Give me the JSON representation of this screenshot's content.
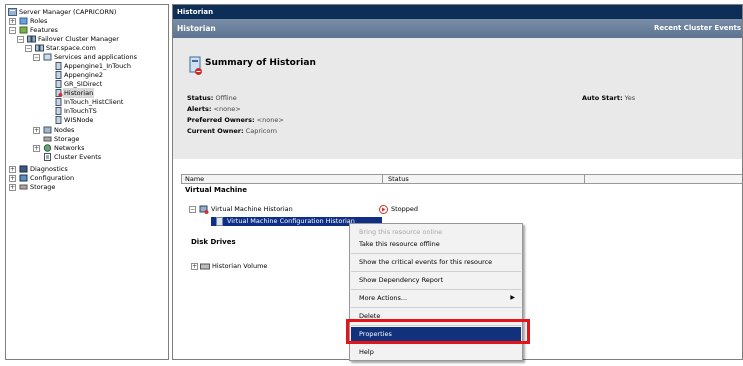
{
  "tree": {
    "items": [
      {
        "label": "Server Manager (CAPRICORN)",
        "expander": ""
      },
      {
        "label": "Roles",
        "expander": "+"
      },
      {
        "label": "Features",
        "expander": "−"
      },
      {
        "label": "Failover Cluster Manager",
        "expander": "−"
      },
      {
        "label": "Star.space.com",
        "expander": "−"
      },
      {
        "label": "Services and applications",
        "expander": "−"
      },
      {
        "label": "Appengine1_InTouch",
        "expander": ""
      },
      {
        "label": "Appengine2",
        "expander": ""
      },
      {
        "label": "GR_SIDirect",
        "expander": ""
      },
      {
        "label": "Historian",
        "expander": "",
        "selected": true
      },
      {
        "label": "InTouch_HistClient",
        "expander": ""
      },
      {
        "label": "InTouchTS",
        "expander": ""
      },
      {
        "label": "WISNode",
        "expander": ""
      },
      {
        "label": "Nodes",
        "expander": "+"
      },
      {
        "label": "Storage",
        "expander": ""
      },
      {
        "label": "Networks",
        "expander": "+"
      },
      {
        "label": "Cluster Events",
        "expander": ""
      },
      {
        "label": "Diagnostics",
        "expander": "+"
      },
      {
        "label": "Configuration",
        "expander": "+"
      },
      {
        "label": "Storage",
        "expander": "+"
      }
    ]
  },
  "header": {
    "top_title": "Historian",
    "sub_title": "Historian",
    "recent_events": "Recent Cluster Events"
  },
  "summary": {
    "title": "Summary of Historian",
    "status_label": "Status:",
    "status_value": "Offline",
    "alerts_label": "Alerts:",
    "alerts_value": "<none>",
    "preferred_owners_label": "Preferred Owners:",
    "preferred_owners_value": "<none>",
    "current_owner_label": "Current Owner:",
    "current_owner_value": "Capricorn",
    "auto_start_label": "Auto Start:",
    "auto_start_value": "Yes"
  },
  "table": {
    "col_name": "Name",
    "col_status": "Status",
    "group_vm": "Virtual Machine",
    "vm_name": "Virtual Machine Historian",
    "vm_status": "Stopped",
    "vm_config": "Virtual Machine Configuration Historian",
    "group_disk": "Disk Drives",
    "disk_name": "Historian Volume"
  },
  "context_menu": {
    "bring_online": "Bring this resource online",
    "take_offline": "Take this resource offline",
    "show_critical": "Show the critical events for this resource",
    "show_dependency": "Show Dependency Report",
    "more_actions": "More Actions...",
    "delete": "Delete",
    "properties": "Properties",
    "help": "Help"
  },
  "colors": {
    "header_dark": "#0d2e56",
    "selection": "#11317c",
    "highlight_box": "#e3151a"
  }
}
